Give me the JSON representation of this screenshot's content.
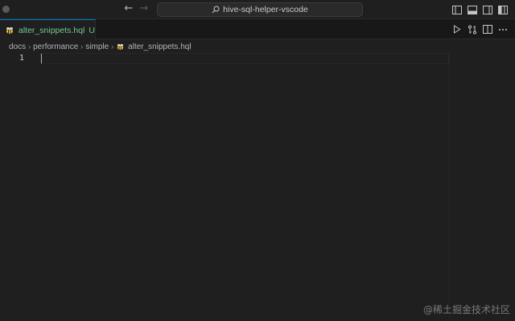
{
  "titlebar": {
    "search_text": "hive-sql-helper-vscode",
    "icons": [
      "window-dot",
      "arrow-left-icon",
      "arrow-right-icon",
      "search-icon",
      "toggle-primary-sidebar-icon",
      "toggle-panel-icon",
      "toggle-secondary-sidebar-icon",
      "customize-layout-icon"
    ]
  },
  "tab": {
    "file_name": "alter_snippets.hql",
    "status": "U",
    "icon": "hive-bee-icon"
  },
  "editor_actions": [
    "run-icon",
    "compare-changes-icon",
    "split-editor-icon",
    "more-actions-icon"
  ],
  "breadcrumb": {
    "items": [
      "docs",
      "performance",
      "simple"
    ],
    "file": "alter_snippets.hql"
  },
  "editor": {
    "line_numbers": [
      "1"
    ]
  },
  "watermark": "@稀土掘金技术社区",
  "colors": {
    "background": "#1f1f1f",
    "accent": "#0078d4",
    "untracked": "#73c991"
  }
}
